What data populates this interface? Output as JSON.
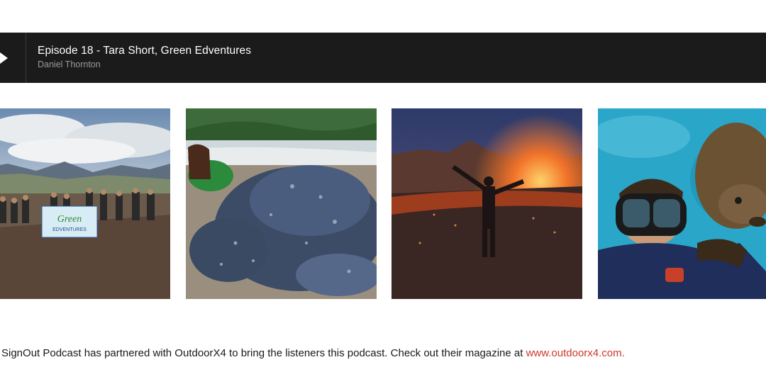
{
  "player": {
    "episode_title": "Episode 18 - Tara Short, Green Edventures",
    "author": "Daniel Thornton",
    "play_icon": "play-icon"
  },
  "gallery": {
    "images": [
      {
        "name": "hikers-group-photo",
        "banner_text": "Green Edventures"
      },
      {
        "name": "leatherback-turtle-photo"
      },
      {
        "name": "volcano-eruption-photo"
      },
      {
        "name": "sea-lion-diver-photo"
      }
    ]
  },
  "footer": {
    "text": "SignOut Podcast has partnered with OutdoorX4 to bring the listeners this podcast.  Check out their magazine at ",
    "link_text": "www.outdoorx4.com."
  }
}
